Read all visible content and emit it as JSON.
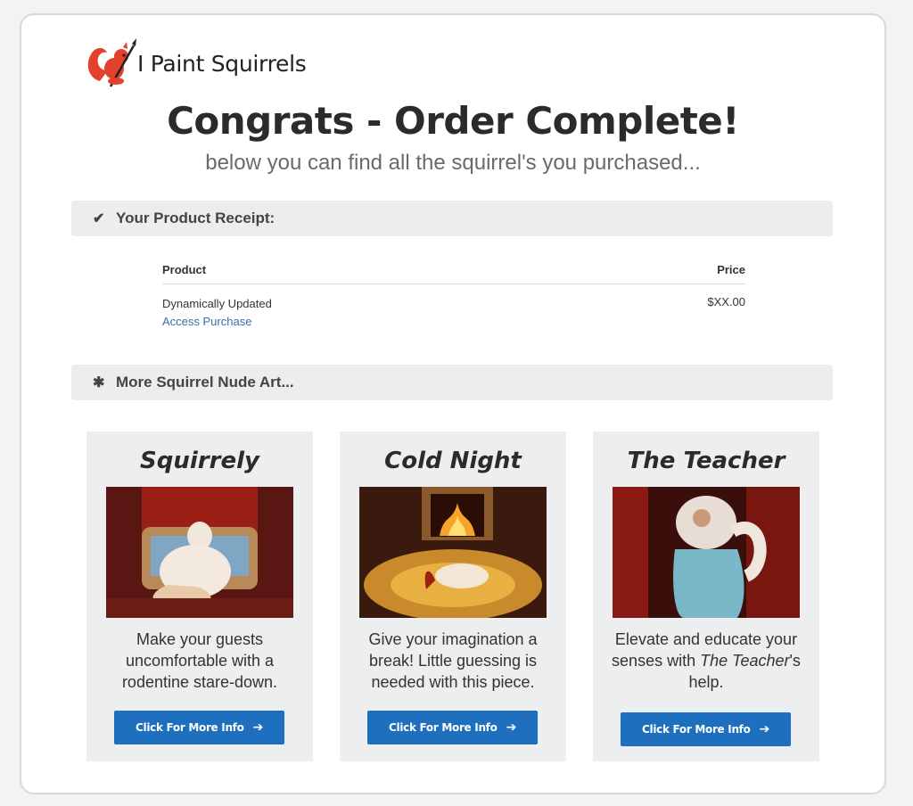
{
  "brand": {
    "name": "I Paint Squirrels",
    "logo_icon": "squirrel-painter-icon"
  },
  "header": {
    "title": "Congrats - Order Complete!",
    "subtitle": "below you can find all the squirrel's you purchased..."
  },
  "receipt": {
    "section_label": "Your Product Receipt:",
    "section_icon": "check-icon",
    "columns": [
      "Product",
      "Price"
    ],
    "rows": [
      {
        "product": "Dynamically Updated",
        "link": "Access Purchase",
        "price": "$XX.00"
      }
    ]
  },
  "more": {
    "section_label": "More Squirrel Nude Art...",
    "section_icon": "asterisk-icon"
  },
  "products": [
    {
      "title": "Squirrely",
      "desc": "Make your guests uncomfortable with a rodentine stare-down.",
      "button": "Click For More Info"
    },
    {
      "title": "Cold Night",
      "desc": "Give your imagination a break! Little guessing is needed with this piece.",
      "button": "Click For More Info"
    },
    {
      "title": "The Teacher",
      "desc_pre": "Elevate and educate your senses with ",
      "desc_em": "The Teacher",
      "desc_post": "'s help.",
      "button": "Click For More Info"
    }
  ],
  "colors": {
    "accent": "#1f6fbf",
    "link": "#3a6fa8",
    "bar": "#ebedee"
  }
}
